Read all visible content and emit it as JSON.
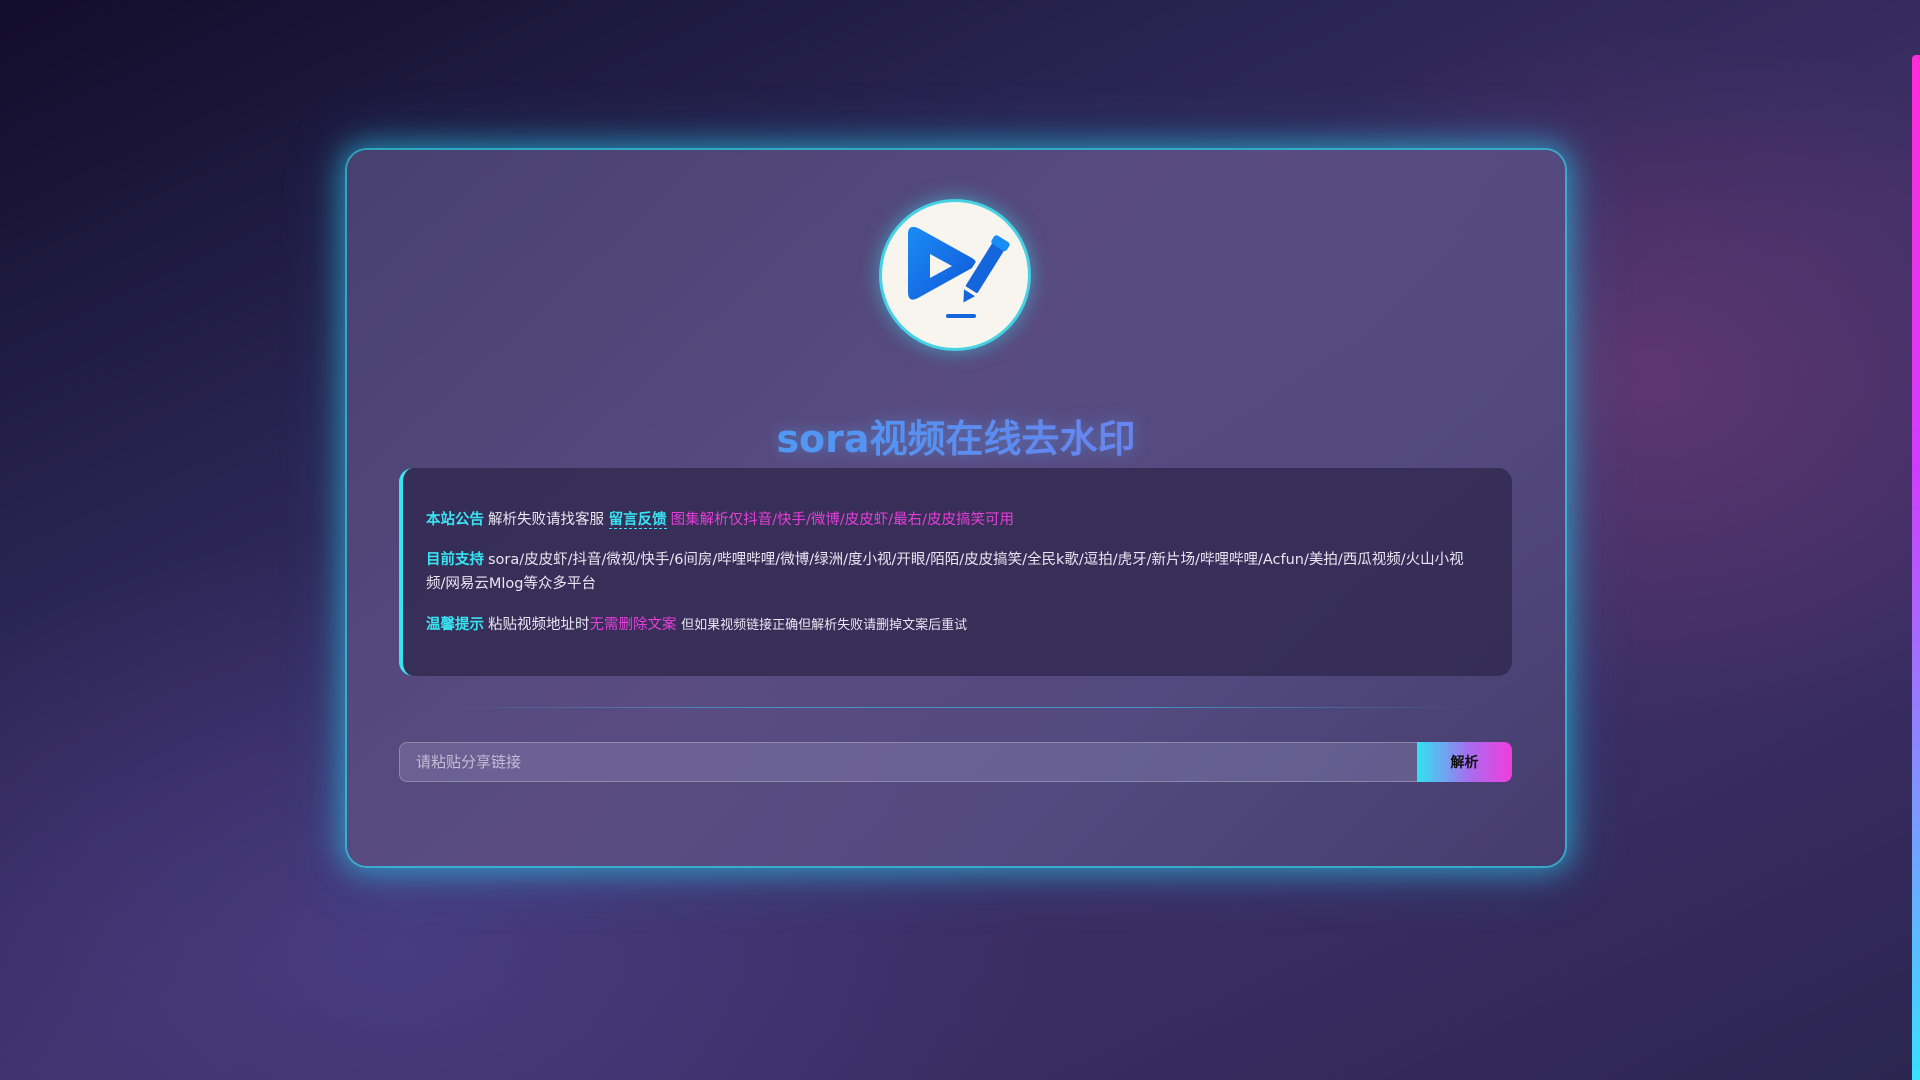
{
  "header": {
    "title": "sora视频在线去水印",
    "logo_icon": "video-edit-icon"
  },
  "notice": {
    "announcement": {
      "label": "本站公告",
      "text": "解析失败请找客服",
      "link": "留言反馈",
      "highlight": "图集解析仅抖音/快手/微博/皮皮虾/最右/皮皮搞笑可用"
    },
    "support": {
      "label": "目前支持",
      "text": "sora/皮皮虾/抖音/微视/快手/6间房/哔哩哔哩/微博/绿洲/度小视/开眼/陌陌/皮皮搞笑/全民k歌/逗拍/虎牙/新片场/哔哩哔哩/Acfun/美拍/西瓜视频/火山小视频/网易云Mlog等众多平台"
    },
    "tip": {
      "label": "温馨提示",
      "text": "粘贴视频地址时",
      "highlight": "无需删除文案",
      "suffix": "但如果视频链接正确但解析失败请删掉文案后重试"
    }
  },
  "search": {
    "placeholder": "请粘贴分享链接",
    "value": "",
    "button_label": "解析"
  },
  "colors": {
    "accent_cyan": "#38e3f2",
    "accent_pink": "#e63ed9",
    "title_blue": "#4aa8f5"
  }
}
